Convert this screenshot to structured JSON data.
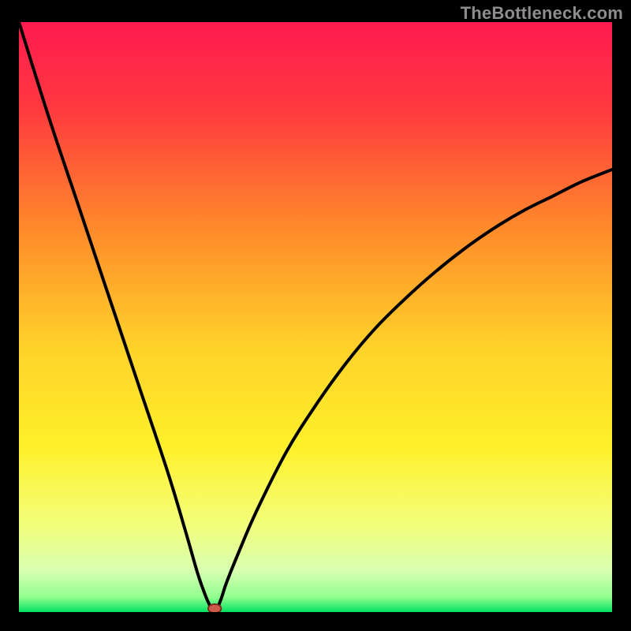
{
  "watermark": {
    "text": "TheBottleneck.com"
  },
  "colors": {
    "black": "#000000",
    "gradient_top": "#ff1a4f",
    "gradient_upper_mid": "#ff7a2a",
    "gradient_mid": "#ffe22a",
    "gradient_lower_mid": "#f6ff7a",
    "gradient_low": "#e6ffc0",
    "gradient_bottom": "#00e060",
    "curve_stroke": "#000000",
    "marker_fill": "#cd5a4a",
    "marker_stroke": "#7c2c20"
  },
  "chart_data": {
    "type": "line",
    "title": "",
    "xlabel": "",
    "ylabel": "",
    "xlim": [
      0,
      100
    ],
    "ylim": [
      0,
      100
    ],
    "notes": "Bottleneck curve: y drops to 0 at x≈33 (optimal point) and rises on both sides; background gradient encodes severity from green (0) to red (100).",
    "series": [
      {
        "name": "left-branch",
        "x": [
          0,
          5,
          10,
          15,
          20,
          25,
          28,
          30,
          31,
          32,
          33
        ],
        "values": [
          100,
          84,
          69,
          54,
          39,
          24,
          14,
          7,
          4,
          1.5,
          0
        ]
      },
      {
        "name": "right-branch",
        "x": [
          33,
          34,
          35,
          37,
          40,
          45,
          50,
          55,
          60,
          65,
          70,
          75,
          80,
          85,
          90,
          95,
          100
        ],
        "values": [
          0,
          2,
          5,
          10,
          17,
          27,
          35,
          42,
          48,
          53,
          57.5,
          61.5,
          65,
          68,
          70.5,
          73,
          75
        ]
      }
    ],
    "marker": {
      "x": 33,
      "y": 0.6
    },
    "gradient_stops": [
      {
        "offset": 0.0,
        "color": "#ff1a4f"
      },
      {
        "offset": 0.15,
        "color": "#ff3a3f"
      },
      {
        "offset": 0.35,
        "color": "#ff8a2a"
      },
      {
        "offset": 0.55,
        "color": "#ffd22a"
      },
      {
        "offset": 0.72,
        "color": "#fff02a"
      },
      {
        "offset": 0.85,
        "color": "#f3ff7a"
      },
      {
        "offset": 0.93,
        "color": "#d8ffb0"
      },
      {
        "offset": 0.975,
        "color": "#90ff90"
      },
      {
        "offset": 1.0,
        "color": "#00e060"
      }
    ]
  }
}
